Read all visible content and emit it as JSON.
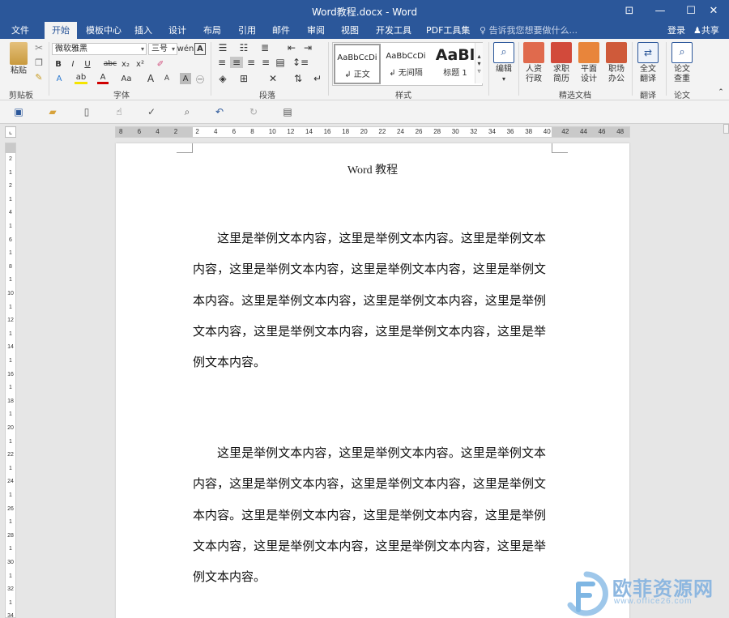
{
  "window": {
    "title": "Word教程.docx - Word",
    "buttons": [
      "⊡",
      "—",
      "☐",
      "✕"
    ]
  },
  "tabs": [
    {
      "label": "文件"
    },
    {
      "label": "开始"
    },
    {
      "label": "模板中心"
    },
    {
      "label": "插入"
    },
    {
      "label": "设计"
    },
    {
      "label": "布局"
    },
    {
      "label": "引用"
    },
    {
      "label": "邮件"
    },
    {
      "label": "审阅"
    },
    {
      "label": "视图"
    },
    {
      "label": "开发工具"
    },
    {
      "label": "PDF工具集"
    }
  ],
  "tell_me": "告诉我您想要做什么...",
  "account": {
    "login": "登录",
    "share": "共享"
  },
  "ribbon": {
    "clipboard": {
      "paste": "粘贴",
      "label": "剪贴板"
    },
    "font": {
      "name": "微软雅黑",
      "size": "三号",
      "label": "字体"
    },
    "paragraph": {
      "label": "段落"
    },
    "styles": {
      "label": "样式",
      "items": [
        {
          "sample": "AaBbCcDi",
          "name": "↲ 正文"
        },
        {
          "sample": "AaBbCcDi",
          "name": "↲ 无间隔"
        },
        {
          "sample": "AaBl",
          "name": "标题 1"
        }
      ]
    },
    "editing": {
      "label": "编辑"
    },
    "templates": {
      "label": "精选文档",
      "items": [
        {
          "line1": "人资",
          "line2": "行政"
        },
        {
          "line1": "求职",
          "line2": "简历"
        },
        {
          "line1": "平面",
          "line2": "设计"
        },
        {
          "line1": "职场",
          "line2": "办公"
        }
      ]
    },
    "translate": {
      "line1": "全文",
      "line2": "翻译",
      "label": "翻译"
    },
    "thesis": {
      "line1": "论文",
      "line2": "查重",
      "label": "论文"
    }
  },
  "ruler": {
    "h_numbers": [
      "8",
      "6",
      "4",
      "2",
      "2",
      "4",
      "6",
      "8",
      "10",
      "12",
      "14",
      "16",
      "18",
      "20",
      "22",
      "24",
      "26",
      "28",
      "30",
      "32",
      "34",
      "36",
      "38",
      "40",
      "42",
      "44",
      "46",
      "48"
    ],
    "v_numbers": [
      "2",
      "1",
      "2",
      "1",
      "4",
      "1",
      "6",
      "1",
      "8",
      "1",
      "10",
      "1",
      "12",
      "1",
      "14",
      "1",
      "16",
      "1",
      "18",
      "1",
      "20",
      "1",
      "22",
      "1",
      "24",
      "1",
      "26",
      "1",
      "28",
      "1",
      "30",
      "1",
      "32",
      "1",
      "34"
    ]
  },
  "document": {
    "title": "Word 教程",
    "paragraphs": [
      "这里是举例文本内容，这里是举例文本内容。这里是举例文本内容，这里是举例文本内容，这里是举例文本内容，这里是举例文本内容。这里是举例文本内容，这里是举例文本内容，这里是举例文本内容，这里是举例文本内容，这里是举例文本内容，这里是举例文本内容。",
      "这里是举例文本内容，这里是举例文本内容。这里是举例文本内容，这里是举例文本内容，这里是举例文本内容，这里是举例文本内容。这里是举例文本内容，这里是举例文本内容，这里是举例文本内容，这里是举例文本内容，这里是举例文本内容，这里是举例文本内容。"
    ]
  },
  "watermark": {
    "text": "欧菲资源网",
    "url": "www.office26.com"
  },
  "colors": {
    "accent": "#2b579a",
    "ribbon_bg": "#f3f3f3",
    "page_bg": "#ffffff",
    "canvas_bg": "#e6e6e6"
  }
}
